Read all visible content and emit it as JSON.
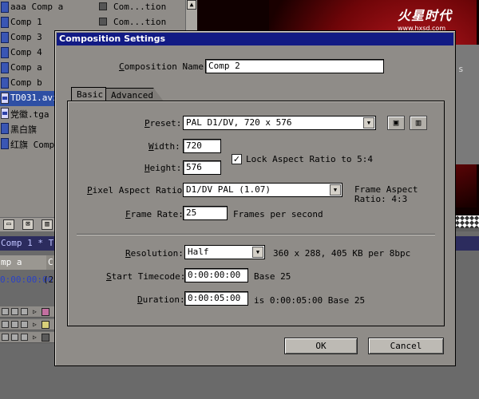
{
  "project_panel": {
    "rows": [
      {
        "name": "aaa Comp a",
        "type": "Com...tion",
        "kind": "comp",
        "selected": false
      },
      {
        "name": "Comp 1",
        "type": "Com...tion",
        "kind": "comp",
        "selected": false
      },
      {
        "name": "Comp 3",
        "type": "",
        "kind": "comp",
        "selected": false
      },
      {
        "name": "Comp 4",
        "type": "",
        "kind": "comp",
        "selected": false
      },
      {
        "name": "Comp a",
        "type": "",
        "kind": "comp",
        "selected": false
      },
      {
        "name": "Comp b",
        "type": "",
        "kind": "comp",
        "selected": false
      },
      {
        "name": "TD031.avi",
        "type": "",
        "kind": "footage",
        "selected": true
      },
      {
        "name": "党徽.tga",
        "type": "",
        "kind": "footage",
        "selected": false
      },
      {
        "name": "黑白旗",
        "type": "",
        "kind": "comp",
        "selected": false
      },
      {
        "name": "红旗 Comp",
        "type": "",
        "kind": "comp",
        "selected": false
      }
    ],
    "scroll_up_icon": "scroll-up-arrow-icon"
  },
  "watermark": {
    "logo_text": "火星时代",
    "url": "www.hxsd.com"
  },
  "timeline": {
    "title": "Comp 1 * Ti",
    "tab": "mp a",
    "tab_next": "C",
    "timecode": "0:00:00:00",
    "timecode_aux": "(25",
    "right_label": "s"
  },
  "dialog": {
    "title": "Composition Settings",
    "composition_name_label": "Composition Name:",
    "composition_name_value": "Comp 2",
    "tabs": [
      {
        "label": "Basic",
        "active": true
      },
      {
        "label": "Advanced",
        "active": false
      }
    ],
    "preset_label": "Preset:",
    "preset_value": "PAL D1/DV, 720 x 576",
    "width_label": "Width:",
    "width_value": "720",
    "height_label": "Height:",
    "height_value": "576",
    "lock_aspect_label": "Lock Aspect Ratio to 5:4",
    "lock_aspect_checked": true,
    "pixel_aspect_label": "Pixel Aspect Ratio:",
    "pixel_aspect_value": "D1/DV PAL (1.07)",
    "frame_aspect_label": "Frame Aspect",
    "frame_aspect_value": "Ratio: 4:3",
    "frame_rate_label": "Frame Rate:",
    "frame_rate_value": "25",
    "frame_rate_unit": "Frames per second",
    "resolution_label": "Resolution:",
    "resolution_value": "Half",
    "resolution_info": "360 x 288, 405 KB per 8bpc",
    "start_timecode_label": "Start Timecode:",
    "start_timecode_value": "0:00:00:00",
    "start_timecode_base": "Base 25",
    "duration_label": "Duration:",
    "duration_value": "0:00:05:00",
    "duration_info": "is 0:00:05:00  Base 25",
    "ok_label": "OK",
    "cancel_label": "Cancel"
  },
  "colors": {
    "titlebar": "#121b84",
    "dialog_bg": "#8f8c88",
    "selection": "#2e4fa4"
  }
}
